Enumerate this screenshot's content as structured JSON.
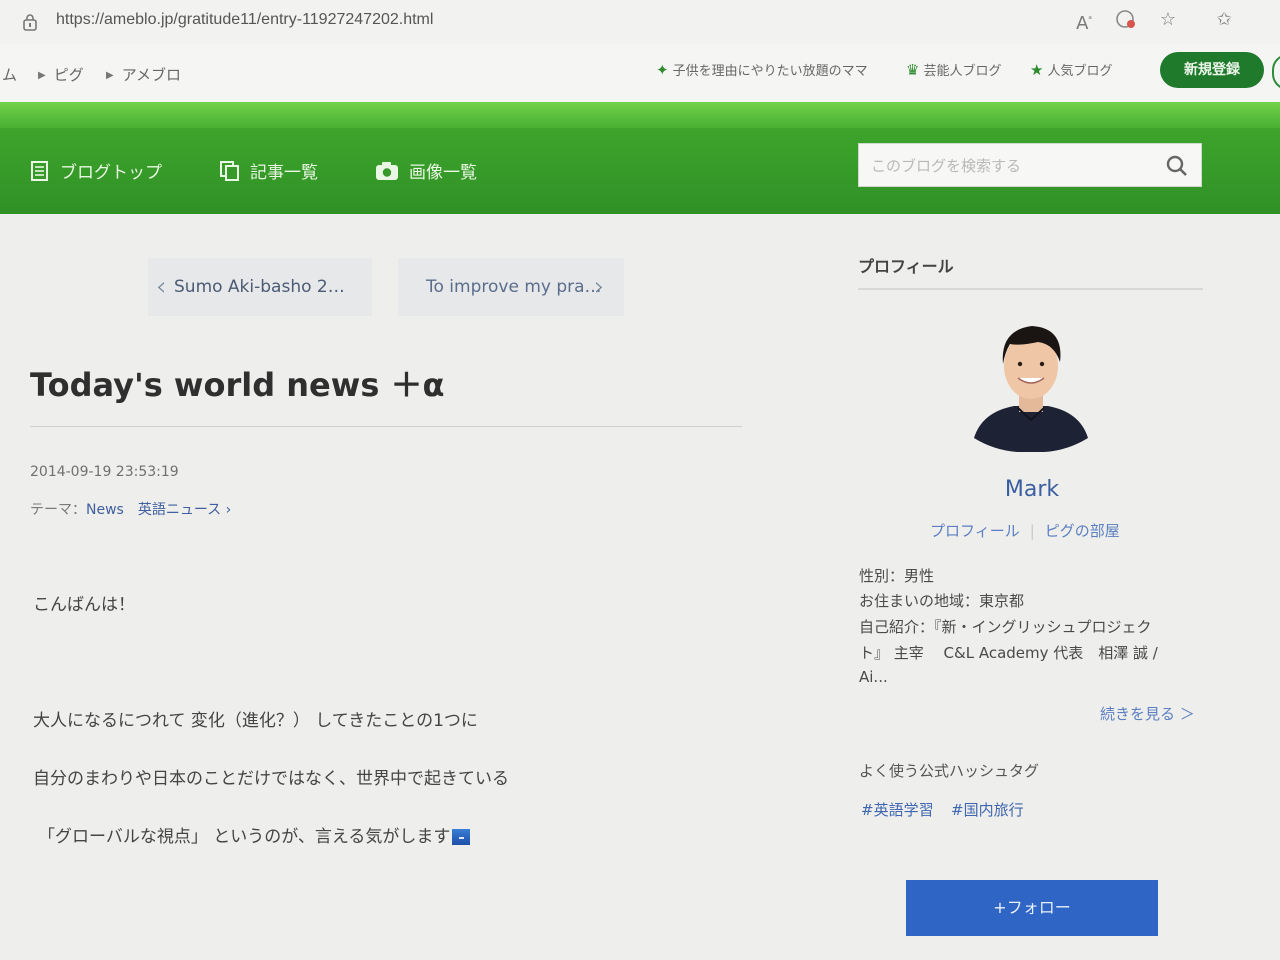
{
  "browser": {
    "url": "https://ameblo.jp/gratitude11/entry-11927247202.html",
    "icons": [
      "read-aloud-icon",
      "tracking-icon",
      "favorites-add-icon",
      "favorites-icon"
    ]
  },
  "ameba_header": {
    "breadcrumbs": [
      "ム",
      "ピグ",
      "アメブロ"
    ],
    "links": [
      {
        "icon": "sparkle-icon",
        "label": "子供を理由にやりたい放題のママ"
      },
      {
        "icon": "crown-icon",
        "label": "芸能人ブログ"
      },
      {
        "icon": "star-icon",
        "label": "人気ブログ"
      }
    ],
    "signup_label": "新規登録"
  },
  "blog_nav": {
    "items": [
      {
        "icon": "document-icon",
        "label": "ブログトップ"
      },
      {
        "icon": "copy-icon",
        "label": "記事一覧"
      },
      {
        "icon": "camera-icon",
        "label": "画像一覧"
      }
    ],
    "search_placeholder": "このブログを検索する"
  },
  "pager": {
    "prev_label": "Sumo Aki-basho 2…",
    "next_label": "To improve my pra…"
  },
  "entry": {
    "title": "Today's world news ＋α",
    "date": "2014-09-19 23:53:19",
    "theme_prefix": "テーマ：",
    "theme": "News　英語ニュース",
    "paragraphs": [
      "こんばんは！",
      "大人になるにつれて 変化（進化？） してきたことの1つに",
      "自分のまわりや日本のことだけではなく、世界中で起きている",
      "「グローバルな視点」 というのが、言える気がします"
    ]
  },
  "sidebar": {
    "profile_heading": "プロフィール",
    "name": "Mark",
    "links": [
      "プロフィール",
      "ピグの部屋"
    ],
    "info": [
      "性別：男性",
      "お住まいの地域：東京都",
      "自己紹介：『新・イングリッシュプロジェク",
      "ト』 主宰　 C&L Academy 代表　相澤 誠 /",
      "Ai..."
    ],
    "more_label": "続きを見る ＞",
    "hashtag_heading": "よく使う公式ハッシュタグ",
    "hashtags": [
      "#英語学習",
      "#国内旅行"
    ],
    "follow_label": "+フォロー"
  }
}
